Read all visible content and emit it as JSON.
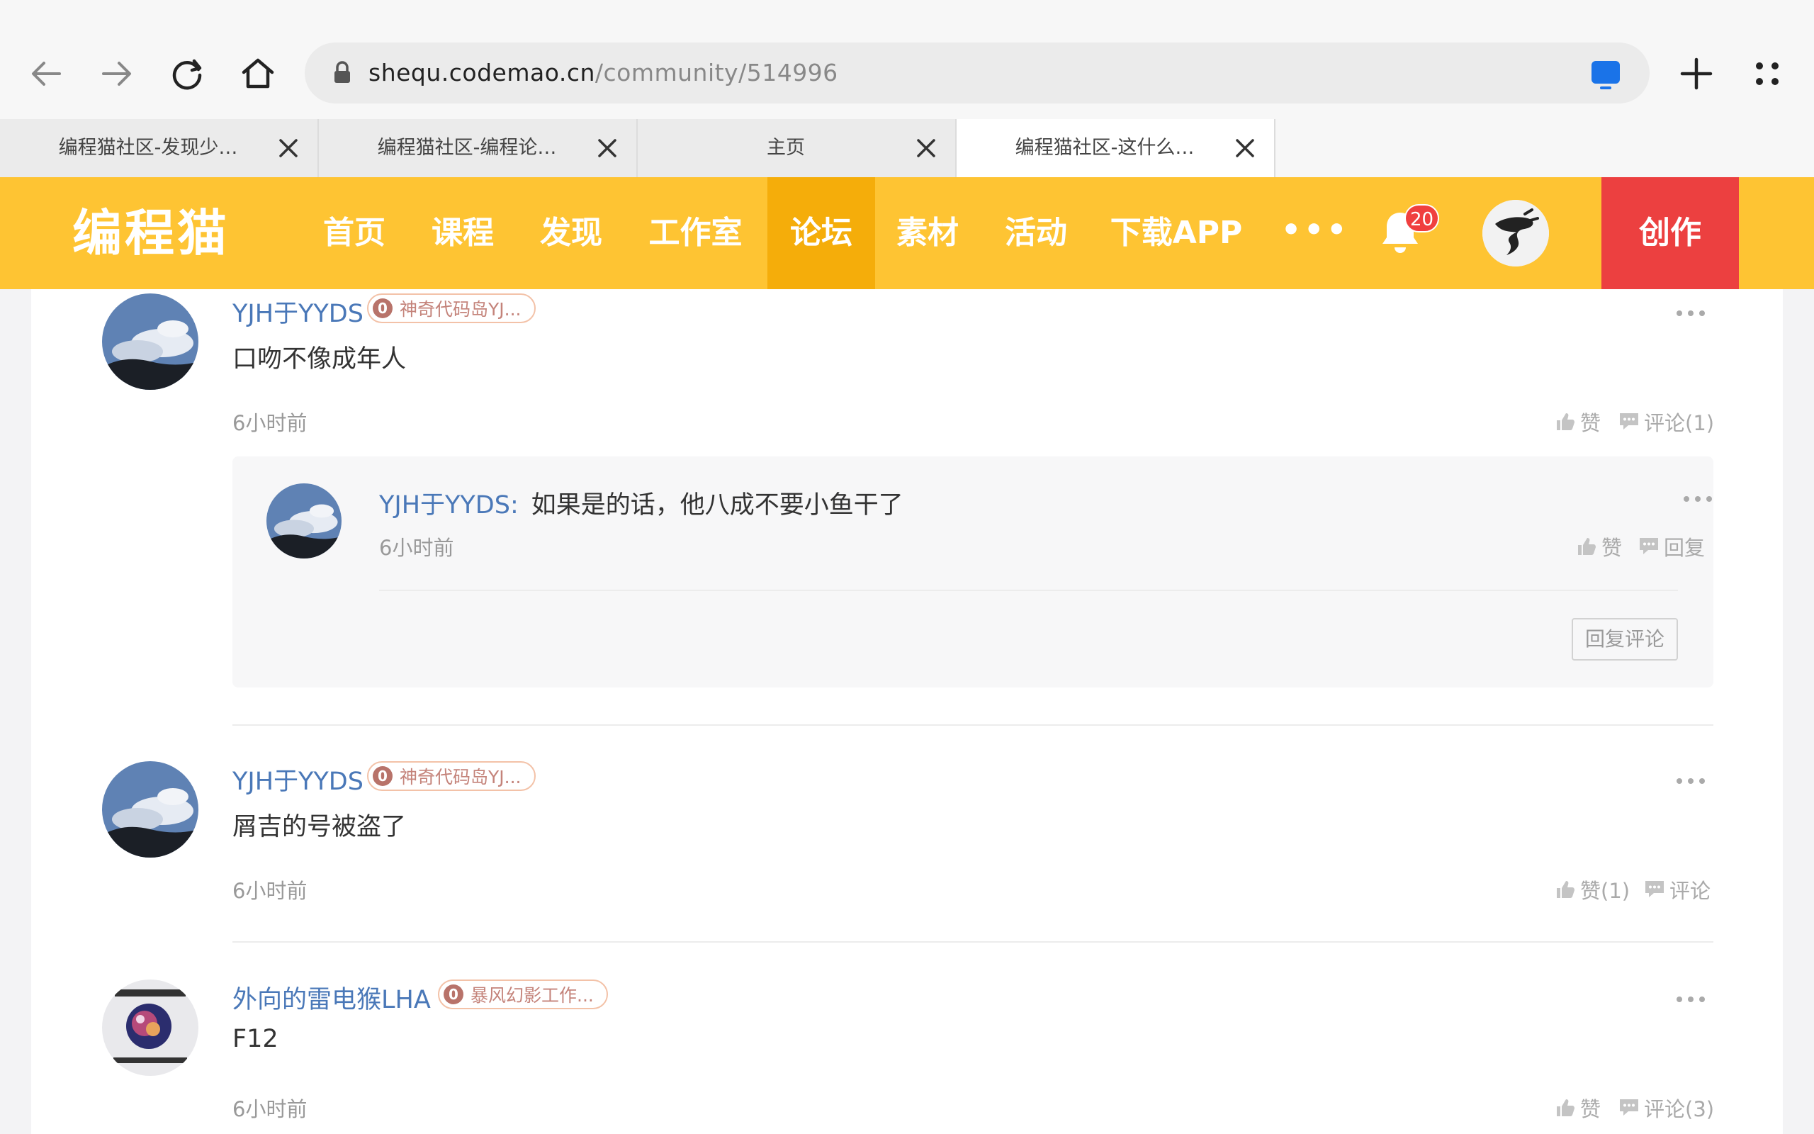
{
  "browser": {
    "url_host": "shequ.codemao.cn",
    "url_path": "/community/514996",
    "tabs": [
      {
        "title": "编程猫社区-发现少…"
      },
      {
        "title": "编程猫社区-编程论…"
      },
      {
        "title": "主页"
      },
      {
        "title": "编程猫社区-这什么…"
      }
    ]
  },
  "site": {
    "logo": "编程猫",
    "menu": [
      "首页",
      "课程",
      "发现",
      "工作室",
      "论坛",
      "素材",
      "活动",
      "下载APP"
    ],
    "more": "•••",
    "notifications": "20",
    "create": "创作"
  },
  "comments": [
    {
      "author": "YJH于YYDS",
      "level": "0",
      "studio": "神奇代码岛YJ...",
      "text": "口吻不像成年人",
      "time": "6小时前",
      "like": "赞",
      "comment": "评论(1)",
      "replies": [
        {
          "author": "YJH于YYDS",
          "separator": ":",
          "text": "如果是的话，他八成不要小鱼干了",
          "time": "6小时前",
          "like": "赞",
          "reply": "回复"
        }
      ],
      "reply_button": "回复评论"
    },
    {
      "author": "YJH于YYDS",
      "level": "0",
      "studio": "神奇代码岛YJ...",
      "text": "屑吉的号被盗了",
      "time": "6小时前",
      "like": "赞(1)",
      "comment": "评论"
    },
    {
      "author": "外向的雷电猴LHA",
      "level": "0",
      "studio": "暴风幻影工作...",
      "text": "F12",
      "time": "6小时前",
      "like": "赞",
      "comment": "评论(3)"
    }
  ],
  "colors": {
    "header_bg": "#fec433",
    "menu_active_bg": "#f5ad0a",
    "create_bg": "#ec4040",
    "username": "#4a78b8"
  }
}
